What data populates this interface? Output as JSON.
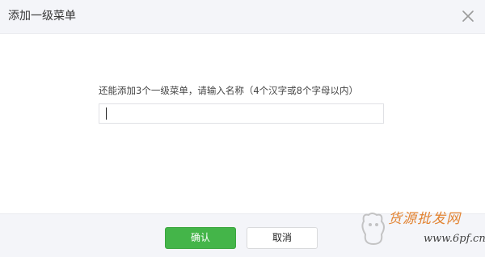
{
  "dialog": {
    "title": "添加一级菜单",
    "close_icon": "close-icon"
  },
  "body": {
    "hint": "还能添加3个一级菜单，请输入名称（4个汉字或8个字母以内）",
    "name_input": {
      "value": "",
      "placeholder": ""
    }
  },
  "footer": {
    "confirm_label": "确认",
    "cancel_label": "取消"
  },
  "watermark": {
    "text": "货源批发网",
    "url": "www.6pf.cn"
  },
  "colors": {
    "header_bg": "#f4f5f9",
    "primary": "#44b549",
    "watermark": "#e07010"
  }
}
